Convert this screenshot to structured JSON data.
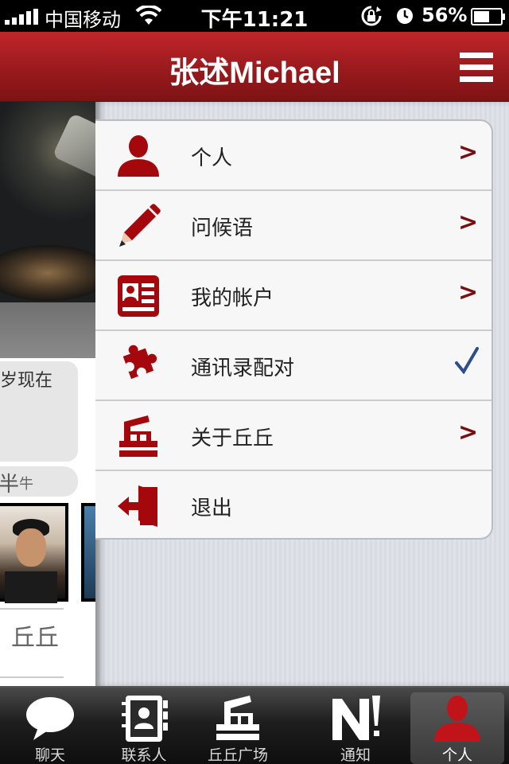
{
  "status_bar": {
    "carrier": "中国移动",
    "time": "下午11:21",
    "battery_percent": "56%",
    "icons": [
      "signal-icon",
      "wifi-icon",
      "rotation-lock-icon",
      "alarm-icon",
      "battery-icon"
    ]
  },
  "nav": {
    "title": "张述Michael",
    "menu_icon": "hamburger-menu-icon"
  },
  "profile_peek": {
    "bubble_text": "岁现在",
    "tag_text": "牛",
    "section_label": "丘丘"
  },
  "menu": {
    "items": [
      {
        "label": "个人",
        "icon": "person-icon",
        "accessory": ">"
      },
      {
        "label": "问候语",
        "icon": "pencil-icon",
        "accessory": ">"
      },
      {
        "label": "我的帐户",
        "icon": "id-card-icon",
        "accessory": ">"
      },
      {
        "label": "通讯录配对",
        "icon": "puzzle-icon",
        "accessory": "check"
      },
      {
        "label": "关于丘丘",
        "icon": "qiuqiu-logo-icon",
        "accessory": ">"
      },
      {
        "label": "退出",
        "icon": "exit-icon",
        "accessory": ""
      }
    ]
  },
  "tabbar": {
    "tabs": [
      {
        "label": "聊天",
        "icon": "chat-bubble-icon",
        "active": false
      },
      {
        "label": "联系人",
        "icon": "contacts-book-icon",
        "active": false
      },
      {
        "label": "丘丘广场",
        "icon": "qiuqiu-plaza-icon",
        "active": false
      },
      {
        "label": "通知",
        "icon": "notification-icon",
        "active": false
      },
      {
        "label": "个人",
        "icon": "person-icon",
        "active": true
      }
    ]
  },
  "colors": {
    "brand_red": "#a0161a",
    "icon_red": "#a5080c",
    "check_blue": "#2e4e8a"
  }
}
